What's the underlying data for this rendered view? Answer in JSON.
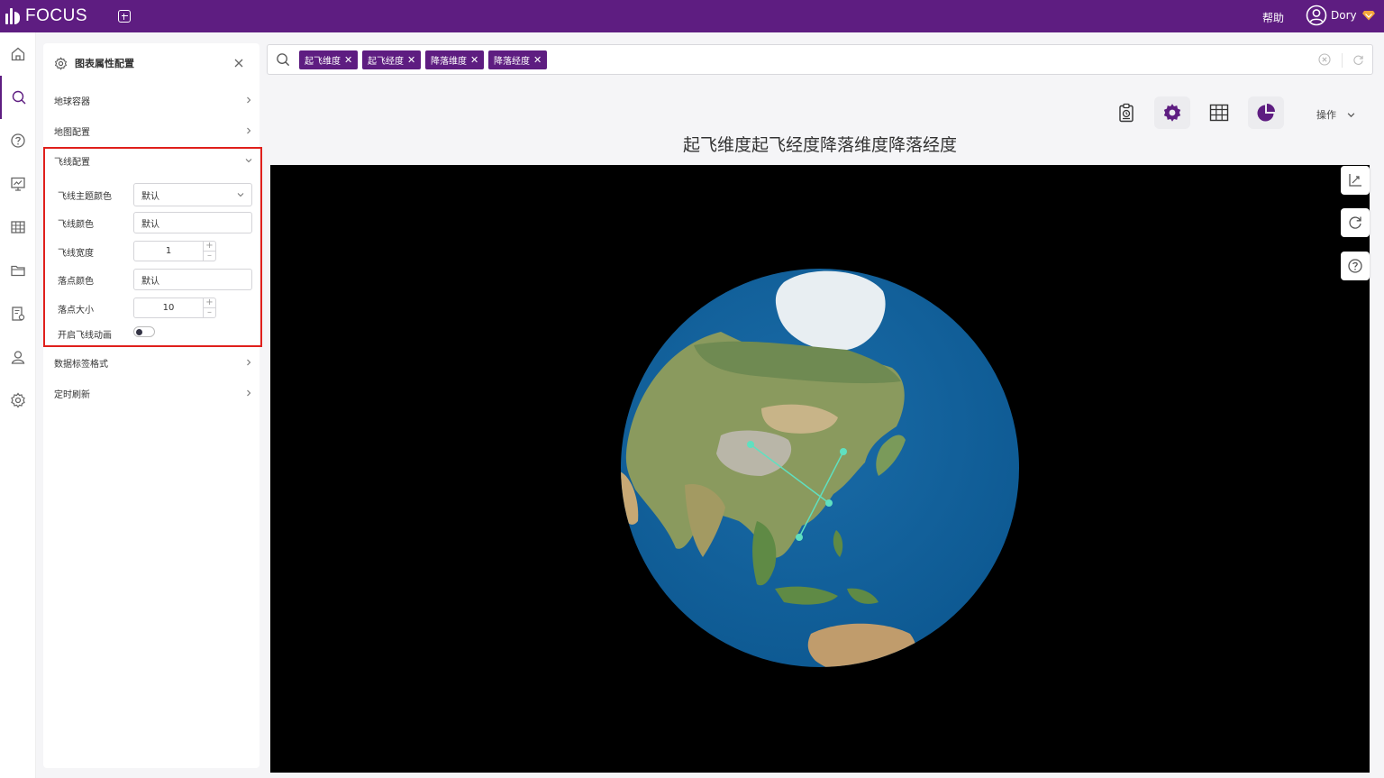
{
  "app": {
    "logo_text": "FOCUS",
    "help_label": "帮助",
    "user_name": "Dory",
    "brand_color": "#5e1d81"
  },
  "nav": [
    {
      "icon": "home-icon"
    },
    {
      "icon": "search-icon",
      "active": true
    },
    {
      "icon": "question-icon"
    },
    {
      "icon": "dashboard-icon"
    },
    {
      "icon": "table-icon"
    },
    {
      "icon": "folder-icon"
    },
    {
      "icon": "data-settings-icon"
    },
    {
      "icon": "user-icon"
    },
    {
      "icon": "gear-icon"
    }
  ],
  "panel": {
    "title": "图表属性配置",
    "sections": {
      "globe_container": "地球容器",
      "map_config": "地图配置",
      "flight_config": "飞线配置",
      "data_label_format": "数据标签格式",
      "timed_refresh": "定时刷新"
    },
    "flight": {
      "theme_color_label": "飞线主题颜色",
      "theme_color_value": "默认",
      "line_color_label": "飞线颜色",
      "line_color_value": "默认",
      "line_width_label": "飞线宽度",
      "line_width_value": "1",
      "point_color_label": "落点颜色",
      "point_color_value": "默认",
      "point_size_label": "落点大小",
      "point_size_value": "10",
      "animation_label": "开启飞线动画",
      "animation_on": false
    }
  },
  "search": {
    "chips": [
      "起飞维度",
      "起飞经度",
      "降落维度",
      "降落经度"
    ]
  },
  "toolbar": {
    "ops_label": "操作"
  },
  "chart": {
    "title": "起飞维度起飞经度降落维度降落经度",
    "background": "#000000",
    "ocean_color": "#11619c",
    "flight_line_color": "#5fe0c0"
  }
}
